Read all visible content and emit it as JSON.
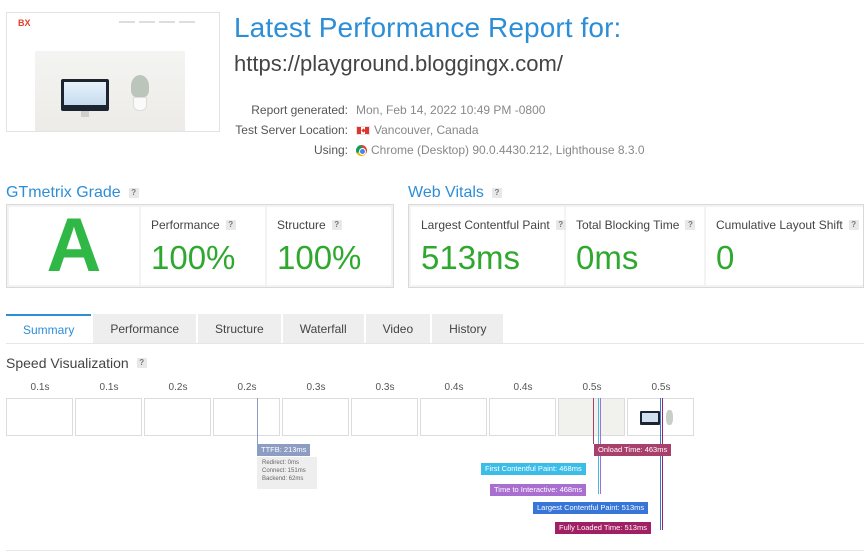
{
  "report": {
    "title": "Latest Performance Report for:",
    "url": "https://playground.bloggingx.com/",
    "thumbnail_logo": "BX"
  },
  "meta": [
    {
      "label": "Report generated:",
      "value": "Mon, Feb 14, 2022 10:49 PM -0800",
      "icon": ""
    },
    {
      "label": "Test Server Location:",
      "value": "Vancouver, Canada",
      "icon": "canada-flag-icon"
    },
    {
      "label": "Using:",
      "value": "Chrome (Desktop) 90.0.4430.212, Lighthouse 8.3.0",
      "icon": "chrome-icon"
    }
  ],
  "grade": {
    "title": "GTmetrix Grade",
    "letter": "A",
    "performance_label": "Performance",
    "performance_value": "100%",
    "structure_label": "Structure",
    "structure_value": "100%"
  },
  "vitals": {
    "title": "Web Vitals",
    "lcp_label": "Largest Contentful Paint",
    "lcp_value": "513ms",
    "tbt_label": "Total Blocking Time",
    "tbt_value": "0ms",
    "cls_label": "Cumulative Layout Shift",
    "cls_value": "0"
  },
  "tabs": [
    "Summary",
    "Performance",
    "Structure",
    "Waterfall",
    "Video",
    "History"
  ],
  "active_tab": "Summary",
  "speed": {
    "title": "Speed Visualization",
    "ticks": [
      "0.1s",
      "0.1s",
      "0.2s",
      "0.2s",
      "0.3s",
      "0.3s",
      "0.4s",
      "0.4s",
      "0.5s",
      "0.5s"
    ],
    "ttfb_label": "TTFB: 213ms",
    "ttfb_details": [
      "Redirect: 0ms",
      "Connect: 151ms",
      "Backend: 62ms"
    ],
    "onload_label": "Onload Time: 463ms",
    "fcp_label": "First Contentful Paint: 468ms",
    "tti_label": "Time to Interactive: 468ms",
    "lcp_label": "Largest Contentful Paint: 513ms",
    "fully_loaded_label": "Fully Loaded Time: 513ms"
  },
  "colors": {
    "accent": "#2d8ed8",
    "grade_green": "#2fb845",
    "value_green": "#2fa82f",
    "ttfb": "#8c9cc2",
    "onload": "#a8406b",
    "fcp": "#3bbde8",
    "tti": "#a86fd1",
    "lcp": "#3775d8",
    "fully_loaded": "#a11f63"
  }
}
